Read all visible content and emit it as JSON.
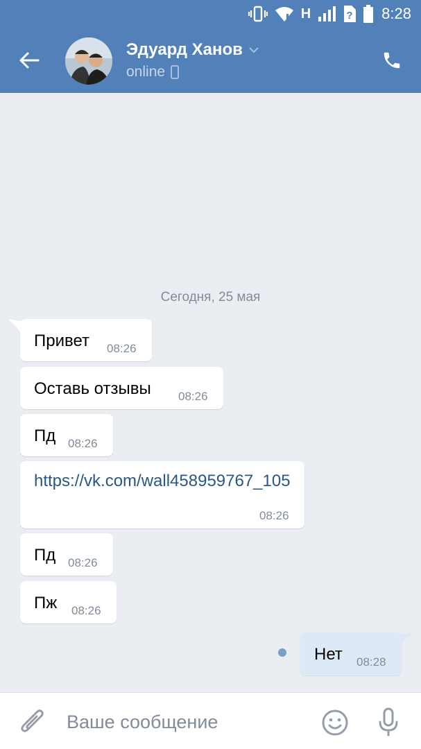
{
  "status_bar": {
    "network_label": "H",
    "time": "8:28",
    "icons": [
      "vibrate-icon",
      "wifi-icon",
      "signal-icon",
      "sim-unknown-icon",
      "battery-icon"
    ]
  },
  "header": {
    "contact_name": "Эдуард Ханов",
    "status": "online",
    "icons": [
      "back-arrow-icon",
      "chevron-down-icon",
      "mobile-device-icon",
      "phone-icon"
    ]
  },
  "conversation": {
    "date_separator": "Сегодня, 25 мая",
    "messages": [
      {
        "direction": "in",
        "text": "Привет",
        "time": "08:26"
      },
      {
        "direction": "in",
        "text": "Оставь отзывы",
        "time": "08:26"
      },
      {
        "direction": "in",
        "text": "Пд",
        "time": "08:26"
      },
      {
        "direction": "in",
        "text": "https://vk.com/wall458959767_105",
        "time": "08:26",
        "is_link": true
      },
      {
        "direction": "in",
        "text": "Пд",
        "time": "08:26"
      },
      {
        "direction": "in",
        "text": "Пж",
        "time": "08:26"
      },
      {
        "direction": "out",
        "text": "Нет",
        "time": "08:28",
        "unread": true
      }
    ]
  },
  "composer": {
    "placeholder": "Ваше сообщение",
    "value": "",
    "icons": [
      "paperclip-icon",
      "emoji-icon",
      "microphone-icon"
    ]
  },
  "colors": {
    "header_bg": "#5181b8",
    "chat_bg": "#eaeef2",
    "incoming_bubble": "#ffffff",
    "outgoing_bubble": "#dee9f8",
    "link": "#2a5885",
    "meta_text": "#818c99"
  }
}
